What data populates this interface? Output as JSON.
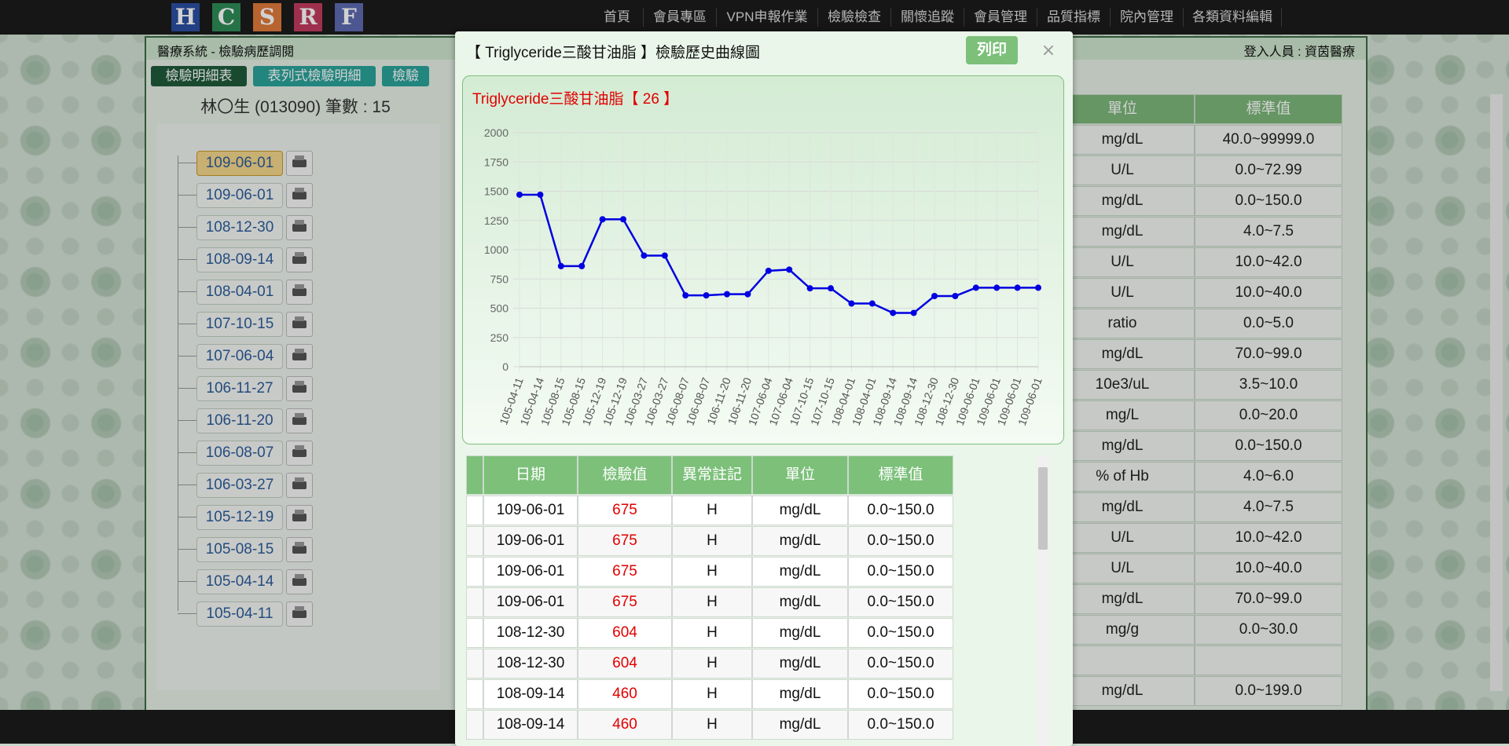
{
  "nav": {
    "logo_letters": [
      "H",
      "C",
      "S",
      "R",
      "F"
    ],
    "logo_colors": [
      "#2b4fa3",
      "#2e8b57",
      "#e07a3b",
      "#c23b5e",
      "#5d6ab0"
    ],
    "items": [
      "首頁",
      "會員專區",
      "VPN申報作業",
      "檢驗檢查",
      "關懷追蹤",
      "會員管理",
      "品質指標",
      "院內管理",
      "各類資料編輯"
    ]
  },
  "base": {
    "title": "醫療系統 - 檢驗病歷調閱",
    "user": "登入人員 : 資茵醫療",
    "tabs": [
      "檢驗明細表",
      "表列式檢驗明細",
      "檢驗"
    ],
    "patient": "林〇生 (013090) 筆數 : 15",
    "dates": [
      "109-06-01",
      "109-06-01",
      "108-12-30",
      "108-09-14",
      "108-04-01",
      "107-10-15",
      "107-06-04",
      "106-11-27",
      "106-11-20",
      "106-08-07",
      "106-03-27",
      "105-12-19",
      "105-08-15",
      "105-04-14",
      "105-04-11"
    ],
    "table_headers": [
      "單位",
      "標準值"
    ],
    "rows": [
      [
        "mg/dL",
        "40.0~99999.0"
      ],
      [
        "U/L",
        "0.0~72.99"
      ],
      [
        "mg/dL",
        "0.0~150.0"
      ],
      [
        "mg/dL",
        "4.0~7.5"
      ],
      [
        "U/L",
        "10.0~42.0"
      ],
      [
        "U/L",
        "10.0~40.0"
      ],
      [
        "ratio",
        "0.0~5.0"
      ],
      [
        "mg/dL",
        "70.0~99.0"
      ],
      [
        "10e3/uL",
        "3.5~10.0"
      ],
      [
        "mg/L",
        "0.0~20.0"
      ],
      [
        "mg/dL",
        "0.0~150.0"
      ],
      [
        "% of Hb",
        "4.0~6.0"
      ],
      [
        "mg/dL",
        "4.0~7.5"
      ],
      [
        "U/L",
        "10.0~42.0"
      ],
      [
        "U/L",
        "10.0~40.0"
      ],
      [
        "mg/dL",
        "70.0~99.0"
      ],
      [
        "mg/g",
        "0.0~30.0"
      ],
      [
        "",
        ""
      ],
      [
        "mg/dL",
        "0.0~199.0"
      ]
    ]
  },
  "modal": {
    "title": "【 Triglyceride三酸甘油脂 】檢驗歷史曲線圖",
    "print_label": "列印",
    "close_label": "×",
    "chart_title": "Triglyceride三酸甘油脂【 26 】",
    "grid_headers": [
      "",
      "日期",
      "檢驗值",
      "異常註記",
      "單位",
      "標準值"
    ],
    "grid_rows": [
      [
        "",
        "109-06-01",
        "675",
        "H",
        "mg/dL",
        "0.0~150.0"
      ],
      [
        "",
        "109-06-01",
        "675",
        "H",
        "mg/dL",
        "0.0~150.0"
      ],
      [
        "",
        "109-06-01",
        "675",
        "H",
        "mg/dL",
        "0.0~150.0"
      ],
      [
        "",
        "109-06-01",
        "675",
        "H",
        "mg/dL",
        "0.0~150.0"
      ],
      [
        "",
        "108-12-30",
        "604",
        "H",
        "mg/dL",
        "0.0~150.0"
      ],
      [
        "",
        "108-12-30",
        "604",
        "H",
        "mg/dL",
        "0.0~150.0"
      ],
      [
        "",
        "108-09-14",
        "460",
        "H",
        "mg/dL",
        "0.0~150.0"
      ],
      [
        "",
        "108-09-14",
        "460",
        "H",
        "mg/dL",
        "0.0~150.0"
      ]
    ]
  },
  "chart_data": {
    "type": "line",
    "title": "Triglyceride三酸甘油脂【 26 】",
    "x": [
      "105-04-11",
      "105-04-14",
      "105-08-15",
      "105-08-15",
      "105-12-19",
      "105-12-19",
      "106-03-27",
      "106-03-27",
      "106-08-07",
      "106-08-07",
      "106-11-20",
      "106-11-20",
      "107-06-04",
      "107-06-04",
      "107-10-15",
      "107-10-15",
      "108-04-01",
      "108-04-01",
      "108-09-14",
      "108-09-14",
      "108-12-30",
      "108-12-30",
      "109-06-01",
      "109-06-01",
      "109-06-01",
      "109-06-01"
    ],
    "values": [
      1470,
      1470,
      860,
      860,
      1260,
      1260,
      950,
      950,
      610,
      610,
      620,
      620,
      820,
      830,
      670,
      670,
      540,
      540,
      460,
      460,
      604,
      604,
      675,
      675,
      675,
      675
    ],
    "ylim": [
      0,
      2000
    ],
    "yticks": [
      0,
      250,
      500,
      750,
      1000,
      1250,
      1500,
      1750,
      2000
    ],
    "grid": true,
    "color": "#0000e0"
  }
}
